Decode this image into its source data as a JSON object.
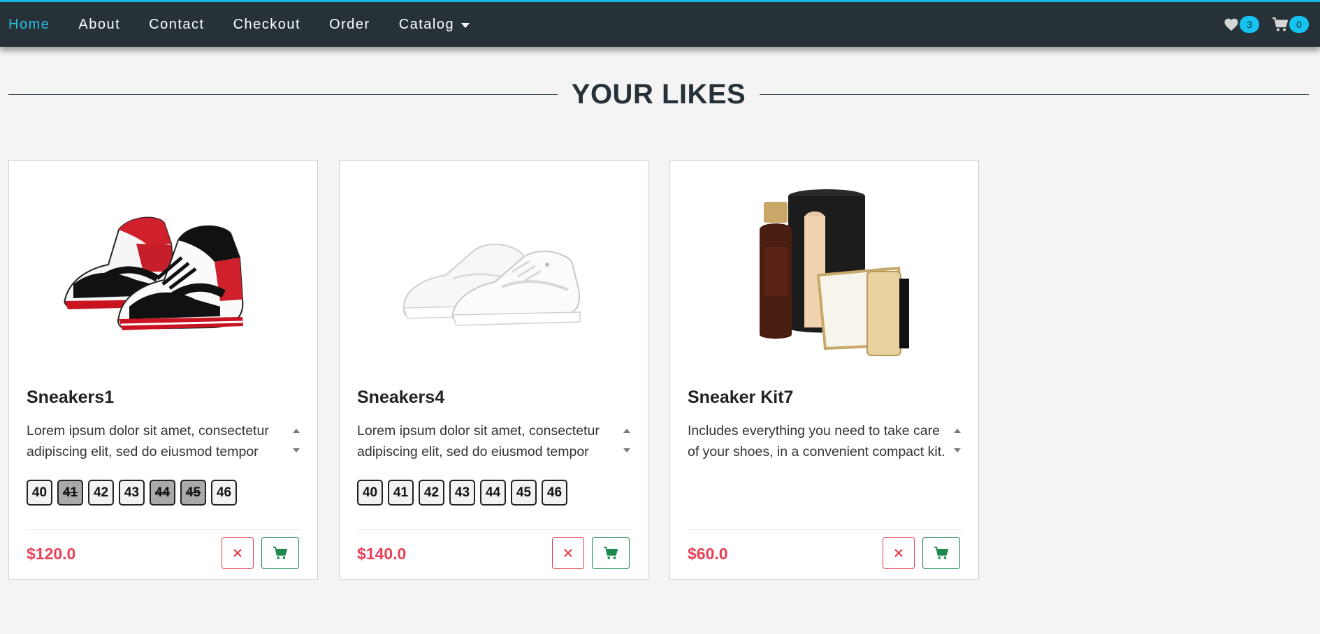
{
  "nav": {
    "links": [
      "Home",
      "About",
      "Contact",
      "Checkout",
      "Order",
      "Catalog"
    ],
    "active": "Home",
    "likes_count": "3",
    "cart_count": "0"
  },
  "section": {
    "title": "YOUR LIKES"
  },
  "cards": [
    {
      "title": "Sneakers1",
      "description": "Lorem ipsum dolor sit amet, consectetur adipiscing elit, sed do eiusmod tempor incididunt ut labore et dolore magna aliqua.",
      "sizes": [
        "40",
        "41",
        "42",
        "43",
        "44",
        "45",
        "46"
      ],
      "unavailable_sizes": [
        "41",
        "44",
        "45"
      ],
      "price": "$120.0",
      "image": "red-black-white-high-top-sneakers"
    },
    {
      "title": "Sneakers4",
      "description": "Lorem ipsum dolor sit amet, consectetur adipiscing elit, sed do eiusmod tempor incididunt ut labore et dolore magna aliqua.",
      "sizes": [
        "40",
        "41",
        "42",
        "43",
        "44",
        "45",
        "46"
      ],
      "unavailable_sizes": [],
      "price": "$140.0",
      "image": "white-low-top-sneakers"
    },
    {
      "title": "Sneaker Kit7",
      "description": "Includes everything you need to take care of your shoes, in a convenient compact kit.",
      "sizes": [],
      "unavailable_sizes": [],
      "price": "$60.0",
      "image": "sneaker-cleaner-kit"
    }
  ],
  "colors": {
    "navbar": "#263238",
    "accent": "#16c3f0",
    "price": "#e84057",
    "remove": "#e23d4f",
    "cart": "#1e8a4f"
  }
}
